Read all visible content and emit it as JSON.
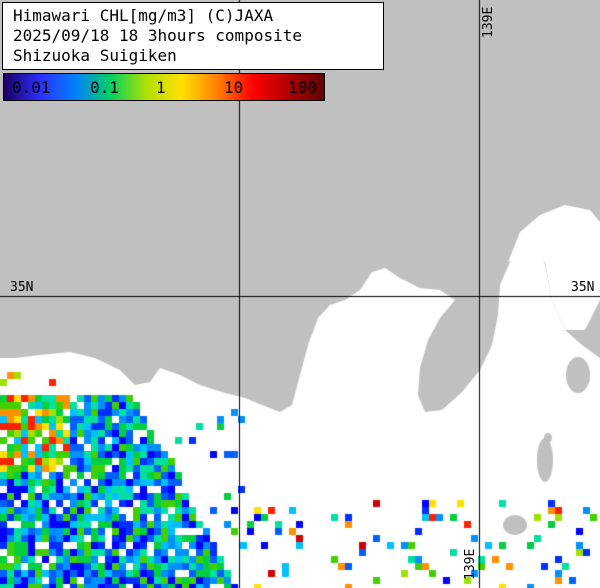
{
  "title": {
    "line1": "Himawari CHL[mg/m3] (C)JAXA",
    "line2": "2025/09/18 18 3hours composite",
    "line3": "Shizuoka Suigiken"
  },
  "colorbar": {
    "ticks": [
      "0.01",
      "0.1",
      "1",
      "10",
      "100"
    ],
    "stops": [
      "#1a0060",
      "#2d2dff",
      "#0080ff",
      "#00d060",
      "#b0e000",
      "#ffe000",
      "#ff8000",
      "#ff0000",
      "#b00000",
      "#600000"
    ]
  },
  "graticule": {
    "lat_label_left": "35N",
    "lat_label_right": "35N",
    "lon_label_top": "139E",
    "lon_label_bottom": "139E"
  },
  "colors": {
    "land": "#c0c0c0",
    "sea": "#ffffff",
    "grid": "#000000"
  }
}
